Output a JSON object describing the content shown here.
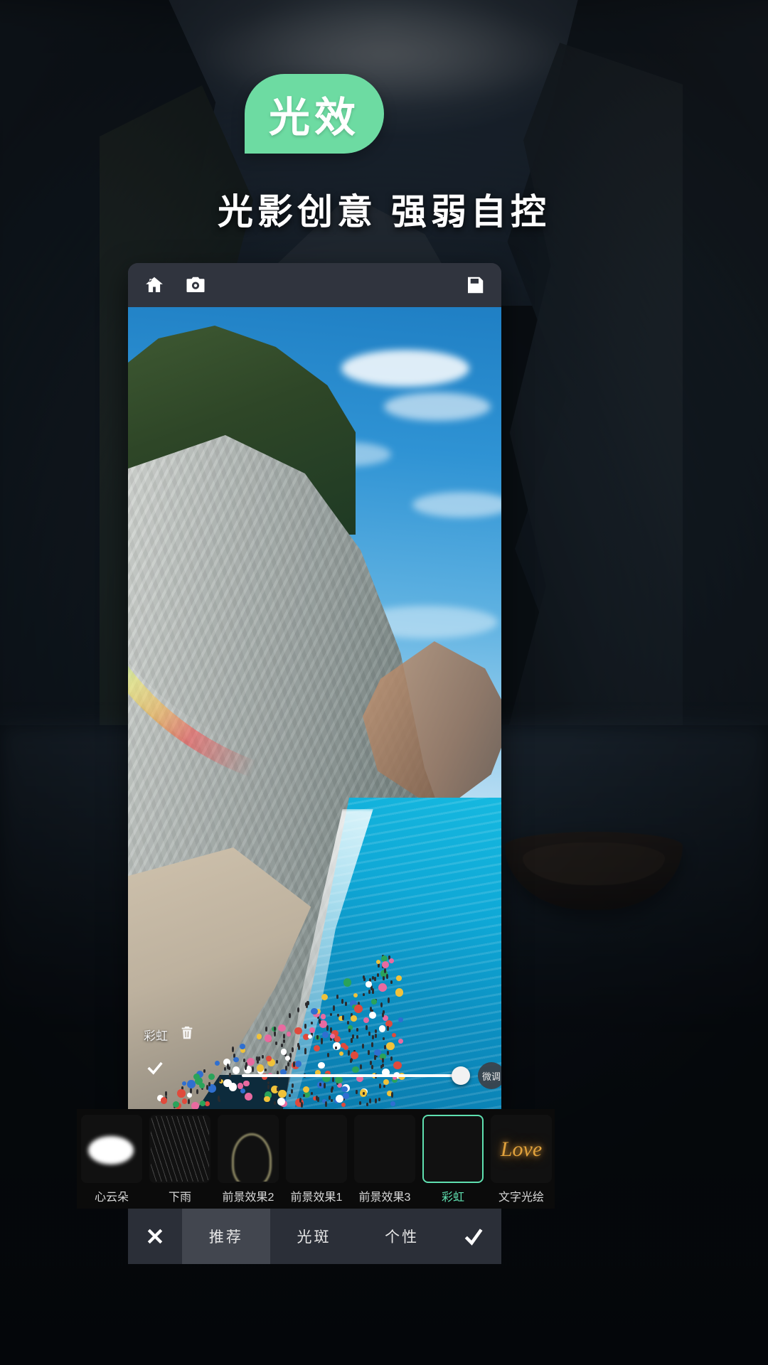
{
  "header": {
    "badge_label": "光效",
    "badge_color": "#6ddba2",
    "subtitle": "光影创意  强弱自控"
  },
  "app": {
    "toolbar": {
      "home_icon": "home-icon",
      "camera_icon": "camera-icon",
      "save_icon": "save-icon"
    },
    "canvas": {
      "overlay_label": "彩虹",
      "trash_icon": "trash-icon",
      "confirm_icon": "check-icon",
      "slider_value": 100,
      "fine_tune_label": "微调"
    },
    "thumbnails": [
      {
        "label": "心云朵",
        "style": "t-cloud",
        "selected": false
      },
      {
        "label": "下雨",
        "style": "t-rain",
        "selected": false
      },
      {
        "label": "前景效果2",
        "style": "t-fx2",
        "selected": false
      },
      {
        "label": "前景效果1",
        "style": "t-fx1",
        "selected": false
      },
      {
        "label": "前景效果3",
        "style": "t-fx3",
        "selected": false
      },
      {
        "label": "彩虹",
        "style": "t-rain2",
        "selected": true
      },
      {
        "label": "文字光绘",
        "style": "t-text",
        "selected": false,
        "art": "Love"
      }
    ],
    "bottom_nav": {
      "close_icon": "close-icon",
      "confirm_icon": "check-icon",
      "tabs": [
        {
          "label": "推荐",
          "active": true
        },
        {
          "label": "光斑",
          "active": false
        },
        {
          "label": "个性",
          "active": false
        }
      ]
    }
  }
}
